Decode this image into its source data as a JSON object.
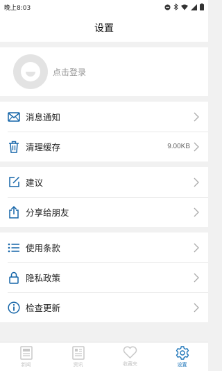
{
  "status_bar": {
    "time": "晚上8:03"
  },
  "header": {
    "title": "设置"
  },
  "profile": {
    "login_label": "点击登录"
  },
  "groups": {
    "g1": [
      {
        "label": "消息通知",
        "icon": "mail-icon"
      },
      {
        "label": "清理缓存",
        "icon": "trash-icon",
        "value": "9.00KB"
      }
    ],
    "g2": [
      {
        "label": "建议",
        "icon": "edit-icon"
      },
      {
        "label": "分享给朋友",
        "icon": "share-icon"
      }
    ],
    "g3": [
      {
        "label": "使用条款",
        "icon": "list-icon"
      },
      {
        "label": "隐私政策",
        "icon": "lock-icon"
      },
      {
        "label": "检查更新",
        "icon": "info-icon"
      }
    ]
  },
  "tabbar": {
    "tabs": [
      {
        "label": "新闻",
        "icon": "news-icon"
      },
      {
        "label": "资讯",
        "icon": "info-doc-icon"
      },
      {
        "label": "收藏夹",
        "icon": "heart-icon"
      },
      {
        "label": "设置",
        "icon": "gear-icon",
        "active": true
      }
    ]
  },
  "colors": {
    "accent": "#1a73b8",
    "icon_blue": "#1565a8",
    "background": "#f1f1f1"
  }
}
